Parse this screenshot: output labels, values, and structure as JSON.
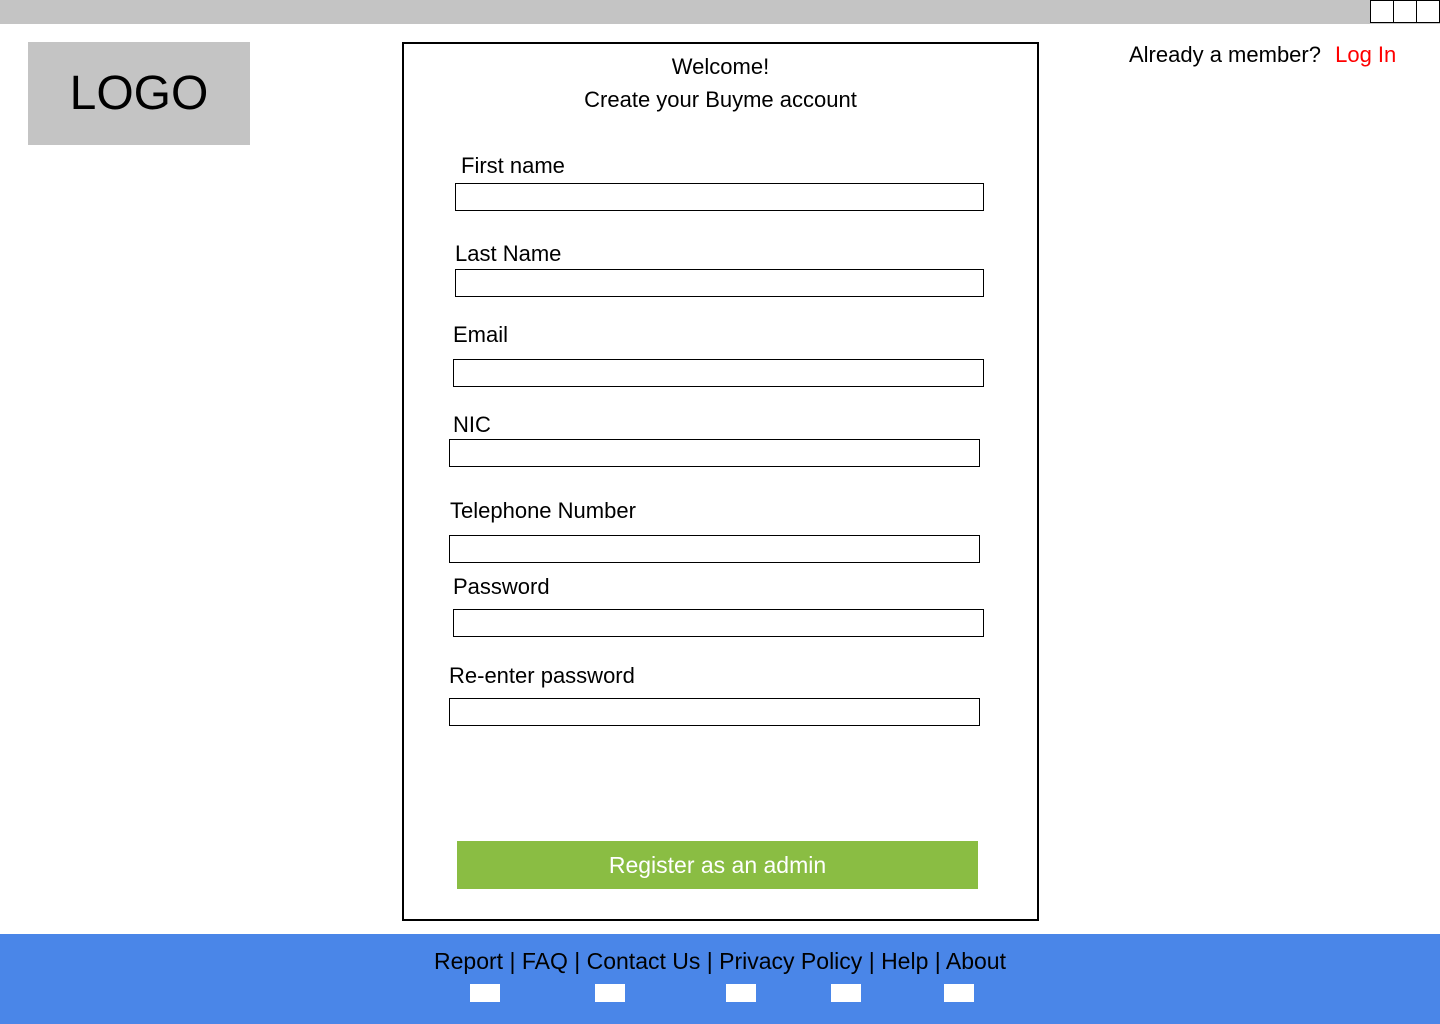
{
  "header": {
    "logo_text": "LOGO",
    "member_prompt": "Already a member?",
    "login_label": "Log In"
  },
  "form": {
    "welcome": "Welcome!",
    "subtitle": "Create your Buyme account",
    "fields": [
      {
        "label": "First name",
        "value": ""
      },
      {
        "label": "Last Name",
        "value": ""
      },
      {
        "label": "Email",
        "value": ""
      },
      {
        "label": "NIC",
        "value": ""
      },
      {
        "label": "Telephone Number",
        "value": ""
      },
      {
        "label": "Password",
        "value": ""
      },
      {
        "label": "Re-enter password",
        "value": ""
      }
    ],
    "submit_label": "Register as an admin"
  },
  "footer": {
    "links": [
      "Report",
      "FAQ",
      "Contact Us",
      "Privacy Policy",
      "Help",
      "About"
    ],
    "separator": "|",
    "social_icons": [
      "social-icon-1",
      "social-icon-2",
      "social-icon-3",
      "social-icon-4",
      "social-icon-5"
    ]
  },
  "colors": {
    "accent_red": "#ff0000",
    "button_green": "#8abd43",
    "footer_blue": "#4a86e8",
    "gray": "#c4c4c4"
  }
}
